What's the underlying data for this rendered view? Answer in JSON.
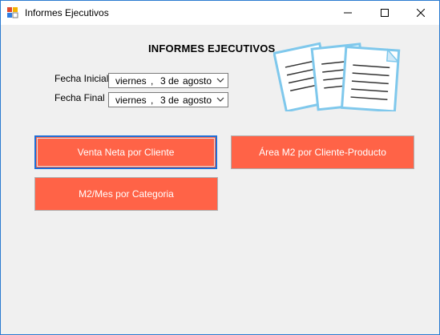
{
  "window": {
    "title": "Informes Ejecutivos"
  },
  "main": {
    "heading": "INFORMES EJECUTIVOS",
    "fecha_inicial": {
      "label": "Fecha Inicial",
      "weekday": "viernes",
      "sep": ",",
      "day": "3 de",
      "month": "agosto"
    },
    "fecha_final": {
      "label": "Fecha Final",
      "weekday": "viernes",
      "sep": ",",
      "day": "3 de",
      "month": "agosto"
    },
    "buttons": {
      "venta_neta": "Venta Neta por Cliente",
      "area_m2": "Área M2 por Cliente-Producto",
      "m2_mes": "M2/Mes por Categoria"
    }
  },
  "colors": {
    "button_bg": "#ff6347",
    "focus_border": "#1e6fd6"
  },
  "icons": {
    "app": "app-icon",
    "documents": "documents-illustration"
  }
}
